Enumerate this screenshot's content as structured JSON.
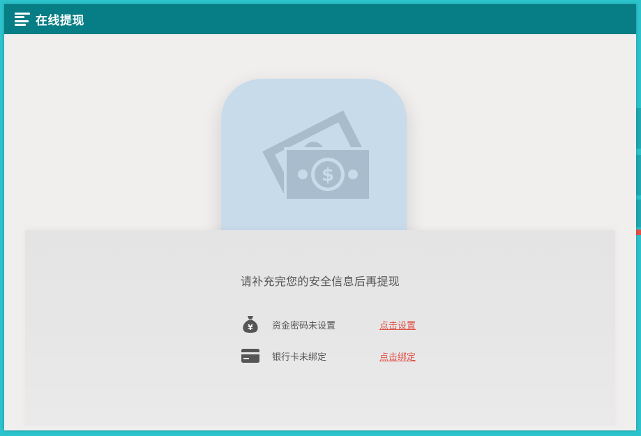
{
  "header": {
    "title": "在线提现"
  },
  "illustration": {
    "icon": "money-cash-icon",
    "tile_color": "#c8dbeb",
    "icon_color": "#a9bccd"
  },
  "panel": {
    "notice": "请补充完您的安全信息后再提现",
    "requirements": [
      {
        "icon": "money-bag-icon",
        "label": "资金密码未设置",
        "action": "点击设置"
      },
      {
        "icon": "credit-card-icon",
        "label": "银行卡未绑定",
        "action": "点击绑定"
      }
    ]
  },
  "colors": {
    "header_bg": "#077d85",
    "frame_border": "#2cc3cc",
    "body_bg": "#f1efee",
    "link": "#e0534a",
    "text": "#555555"
  }
}
